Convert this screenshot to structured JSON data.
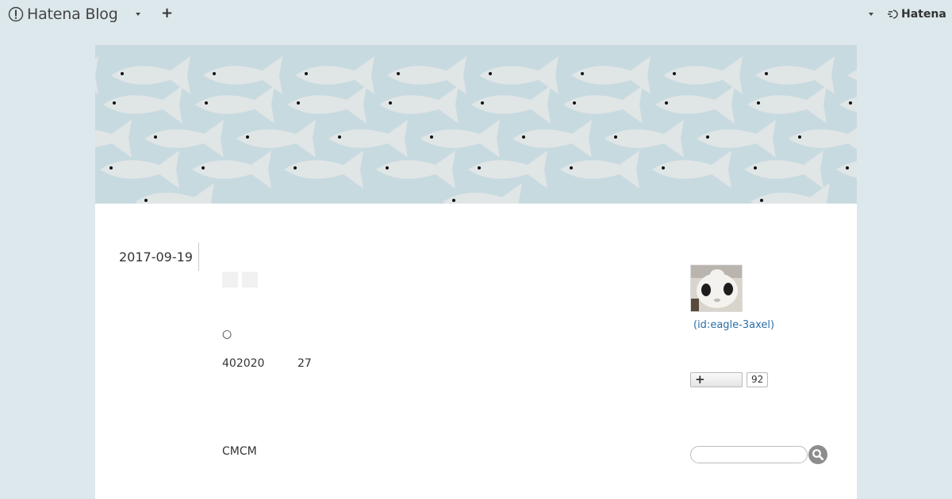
{
  "topbar": {
    "brand_name": "Hatena Blog",
    "plus_label": "+",
    "hatena_label": "Hatena"
  },
  "article": {
    "date": "2017-09-19",
    "circle_mark": "○",
    "line1_a": "402020",
    "line1_b": "27",
    "line2": "CMCM"
  },
  "sidebar": {
    "user_id": "(id:eagle-3axel)",
    "subscribe_plus": "+",
    "subscriber_count": "92",
    "search_placeholder": ""
  },
  "colors": {
    "page_bg": "#dde8ec",
    "banner_bg": "#c7dae0",
    "fish": "#e0e5e6",
    "link": "#2a6fa8"
  }
}
